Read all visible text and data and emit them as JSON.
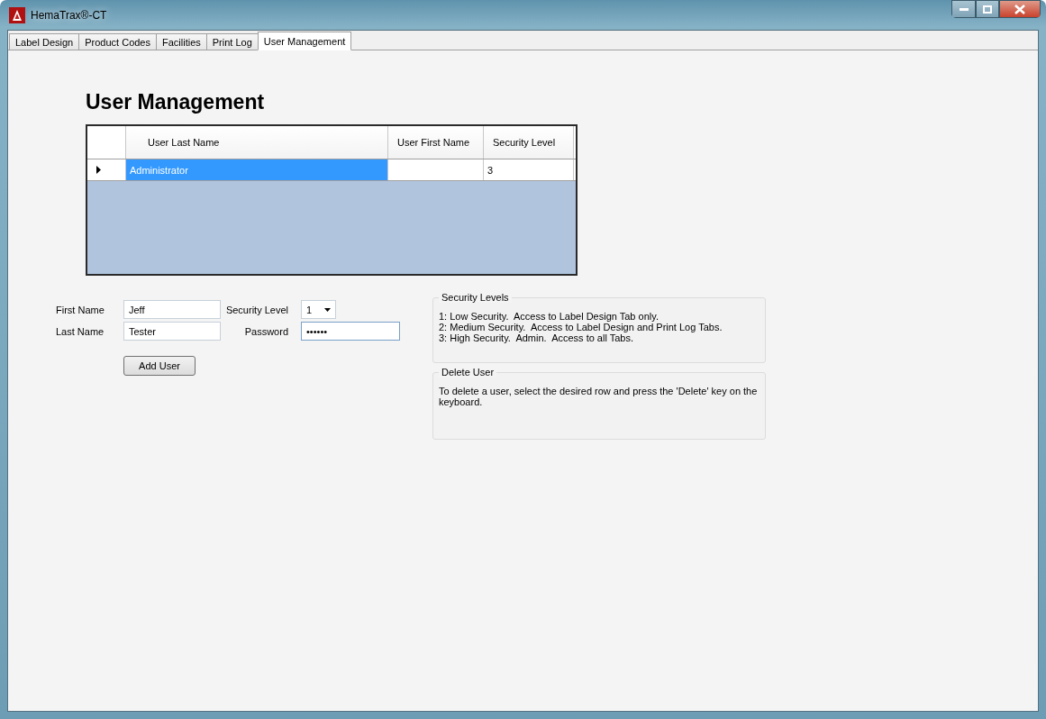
{
  "window": {
    "title": "HemaTrax®-CT"
  },
  "tabs": [
    {
      "label": "Label Design",
      "selected": false
    },
    {
      "label": "Product Codes",
      "selected": false
    },
    {
      "label": "Facilities",
      "selected": false
    },
    {
      "label": "Print Log",
      "selected": false
    },
    {
      "label": "User Management",
      "selected": true
    }
  ],
  "heading": "User Management",
  "table": {
    "columns": [
      "User Last Name",
      "User First Name",
      "Security Level"
    ],
    "rows": [
      {
        "cells": [
          "Administrator",
          "",
          "3"
        ],
        "selected": true,
        "current": true
      }
    ]
  },
  "form": {
    "first_name": {
      "label": "First Name",
      "value": "Jeff"
    },
    "last_name": {
      "label": "Last Name",
      "value": "Tester"
    },
    "security_level": {
      "label": "Security Level",
      "value": "1"
    },
    "password": {
      "label": "Password",
      "value": "••••••"
    },
    "add_button": "Add User"
  },
  "groups": [
    {
      "title": "Security Levels",
      "lines": [
        "1: Low Security.  Access to Label Design Tab only.",
        "2: Medium Security.  Access to Label Design and Print Log Tabs.",
        "3: High Security.  Admin.  Access to all Tabs."
      ]
    },
    {
      "title": "Delete User",
      "lines": [
        "To delete a user, select the desired row and press the 'Delete' key on the keyboard."
      ]
    }
  ]
}
